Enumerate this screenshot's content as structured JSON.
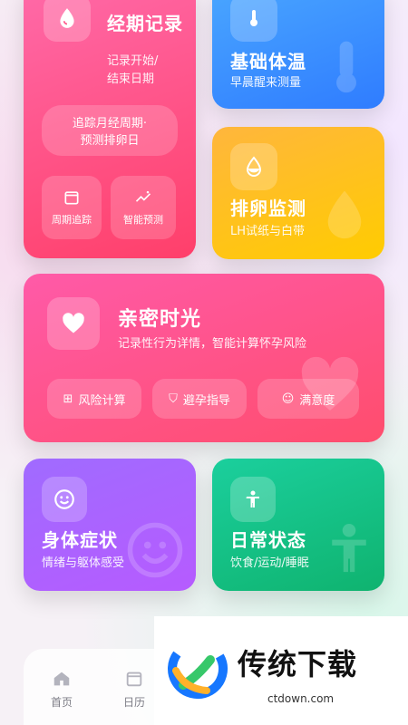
{
  "cards": {
    "period": {
      "title": "经期记录",
      "subtitle_line1": "记录开始/",
      "subtitle_line2": "结束日期",
      "track_button_line1": "追踪月经周期·",
      "track_button_line2": "预测排卵日",
      "mini1": "周期追踪",
      "mini2": "智能预测",
      "icon": "droplet-icon",
      "color_from": "#ff5fa1",
      "color_to": "#ff4468"
    },
    "temperature": {
      "title": "基础体温",
      "subtitle": "早晨醒来测量",
      "icon": "thermometer-icon",
      "color_from": "#4aa7ff",
      "color_to": "#2f7cff"
    },
    "ovulation": {
      "title": "排卵监测",
      "subtitle": "LH试纸与白带",
      "icon": "drop-half-icon",
      "color_from": "#ffb63d",
      "color_to": "#ffc400"
    },
    "intimacy": {
      "title": "亲密时光",
      "subtitle": "记录性行为详情，智能计算怀孕风险",
      "btn1": "风险计算",
      "btn2": "避孕指导",
      "btn3": "满意度",
      "icon": "heart-icon",
      "color_from": "#ff5aa8",
      "color_to": "#ff4d6d"
    },
    "symptoms": {
      "title": "身体症状",
      "subtitle": "情绪与躯体感受",
      "icon": "smile-icon",
      "color_from": "#a06bff",
      "color_to": "#b05cff"
    },
    "daily": {
      "title": "日常状态",
      "subtitle": "饮食/运动/睡眠",
      "icon": "person-icon",
      "color_from": "#18c99a",
      "color_to": "#0fb36f"
    }
  },
  "tabbar": {
    "home": "首页",
    "calendar": "日历"
  },
  "watermark": {
    "brand": "传统下载",
    "url": "ctdown.com"
  }
}
